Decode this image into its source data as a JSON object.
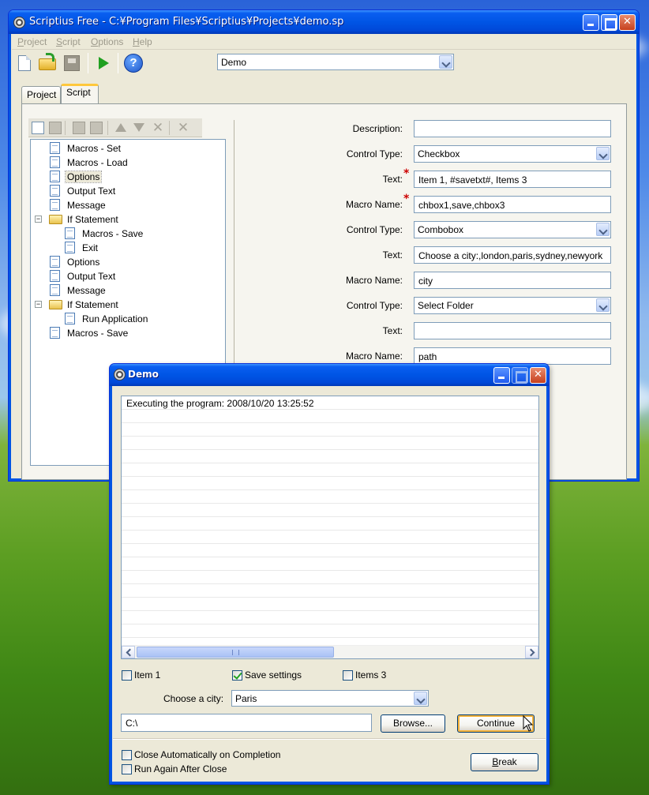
{
  "main": {
    "title": "Scriptius Free - C:¥Program Files¥Scriptius¥Projects¥demo.sp",
    "menu": [
      "Project",
      "Script",
      "Options",
      "Help"
    ],
    "project_combo": "Demo",
    "tabs": [
      "Project",
      "Script"
    ],
    "active_tab": "Script",
    "tree": [
      {
        "label": "Macros - Set",
        "type": "doc",
        "level": 0
      },
      {
        "label": "Macros - Load",
        "type": "doc",
        "level": 0
      },
      {
        "label": "Options",
        "type": "doc",
        "level": 0,
        "selected": true
      },
      {
        "label": "Output Text",
        "type": "doc",
        "level": 0
      },
      {
        "label": "Message",
        "type": "doc",
        "level": 0
      },
      {
        "label": "If Statement",
        "type": "folder",
        "level": 0,
        "expander": "−"
      },
      {
        "label": "Macros - Save",
        "type": "doc",
        "level": 1
      },
      {
        "label": "Exit",
        "type": "doc",
        "level": 1
      },
      {
        "label": "Options",
        "type": "doc",
        "level": 0
      },
      {
        "label": "Output Text",
        "type": "doc",
        "level": 0
      },
      {
        "label": "Message",
        "type": "doc",
        "level": 0
      },
      {
        "label": "If Statement",
        "type": "folder",
        "level": 0,
        "expander": "−"
      },
      {
        "label": "Run Application",
        "type": "doc",
        "level": 1
      },
      {
        "label": "Macros - Save",
        "type": "doc",
        "level": 0
      }
    ],
    "form": [
      {
        "label": "Description:",
        "value": "",
        "kind": "text",
        "required": false
      },
      {
        "label": "Control Type:",
        "value": "Checkbox",
        "kind": "combo",
        "required": false
      },
      {
        "label": "Text:",
        "value": "Item 1, #savetxt#, Items 3",
        "kind": "text",
        "required": true
      },
      {
        "label": "Macro Name:",
        "value": "chbox1,save,chbox3",
        "kind": "text",
        "required": true
      },
      {
        "label": "Control Type:",
        "value": "Combobox",
        "kind": "combo",
        "required": false
      },
      {
        "label": "Text:",
        "value": "Choose a city:,london,paris,sydney,newyork",
        "kind": "text",
        "required": false
      },
      {
        "label": "Macro Name:",
        "value": "city",
        "kind": "text",
        "required": false
      },
      {
        "label": "Control Type:",
        "value": "Select Folder",
        "kind": "combo",
        "required": false
      },
      {
        "label": "Text:",
        "value": "",
        "kind": "text",
        "required": false
      },
      {
        "label": "Macro Name:",
        "value": "path",
        "kind": "text",
        "required": false
      }
    ]
  },
  "demo": {
    "title": "Demo",
    "log_line": "Executing the program: 2008/10/20 13:25:52",
    "checkboxes": [
      {
        "label": "Item 1",
        "checked": false
      },
      {
        "label": "Save settings",
        "checked": true
      },
      {
        "label": "Items 3",
        "checked": false
      }
    ],
    "city_label": "Choose a city:",
    "city_value": "Paris",
    "path_value": "C:\\",
    "browse_label": "Browse...",
    "continue_label": "Continue",
    "close_auto_label": "Close Automatically on Completion",
    "run_again_label": "Run Again After Close",
    "break_label": "Break"
  },
  "colors": {
    "title_bar": "#0055e5",
    "required_mark": "#cc0000",
    "default_button_glow": "#f6b33a"
  }
}
